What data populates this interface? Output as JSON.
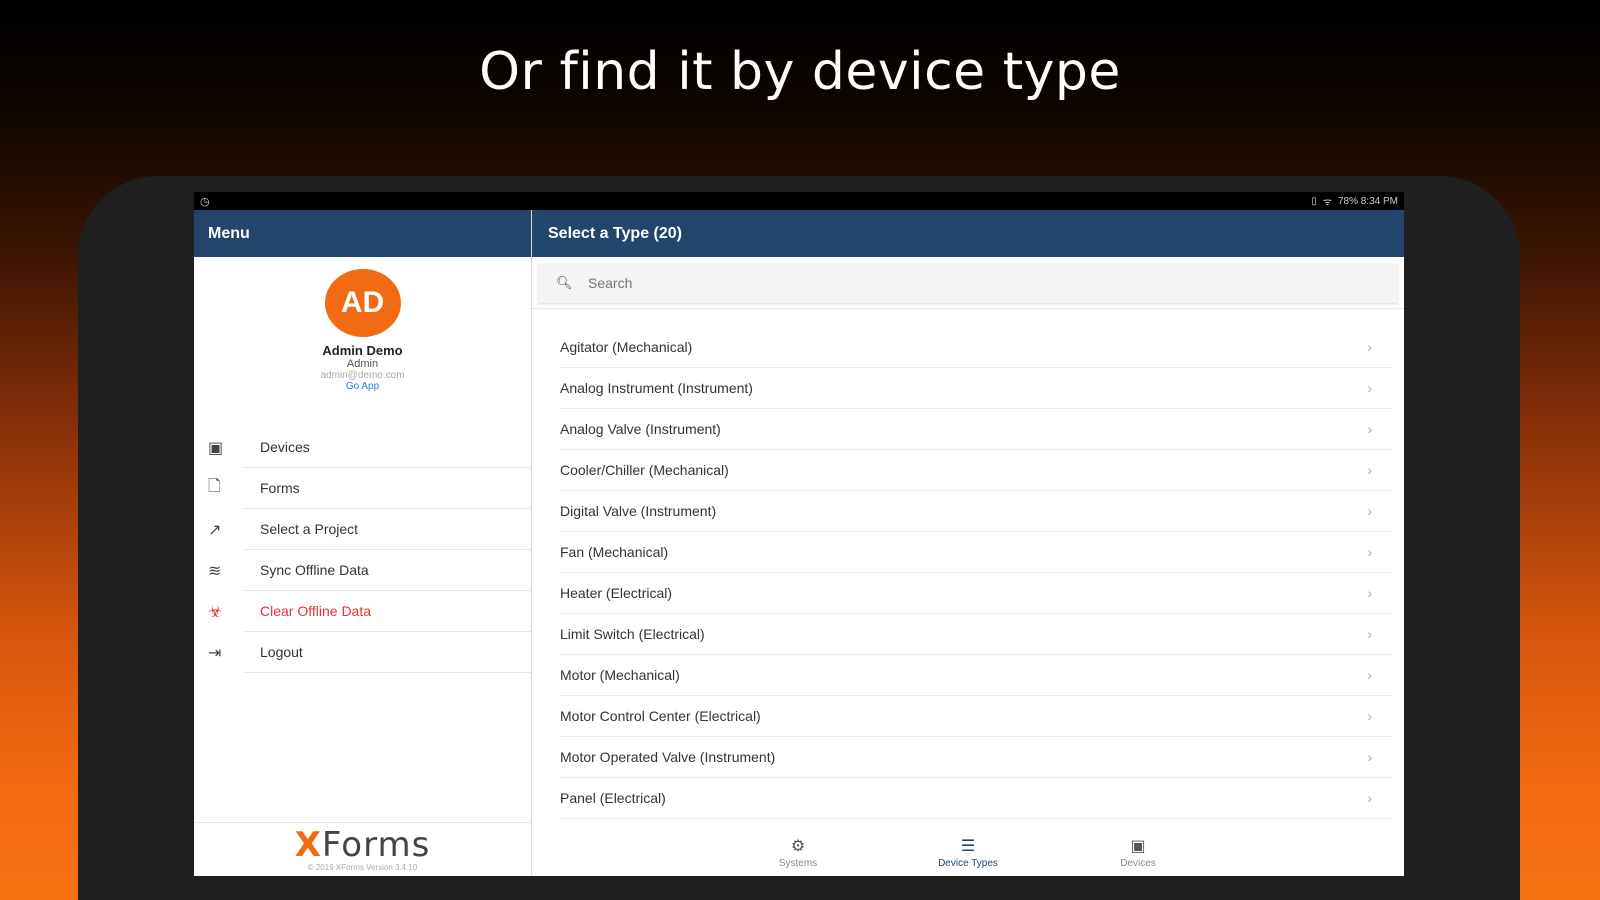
{
  "headline": "Or find it by device type",
  "statusbar": {
    "left_icon": "clock-icon",
    "right_text": "78% 8:34 PM"
  },
  "sidebar": {
    "title": "Menu",
    "profile": {
      "initials": "AD",
      "name": "Admin Demo",
      "role": "Admin",
      "email": "admin@demo.com",
      "link": "Go App"
    },
    "items": [
      {
        "label": "Devices",
        "icon": "device-icon"
      },
      {
        "label": "Forms",
        "icon": "document-icon"
      },
      {
        "label": "Select a Project",
        "icon": "chart-icon"
      },
      {
        "label": "Sync Offline Data",
        "icon": "wifi-icon"
      },
      {
        "label": "Clear Offline Data",
        "icon": "biohazard-icon"
      },
      {
        "label": "Logout",
        "icon": "logout-icon"
      }
    ],
    "logo": {
      "x": "X",
      "rest": "Forms"
    },
    "copyright": "© 2019 XForms Version 3.4.10"
  },
  "main": {
    "title": "Select a Type (20)",
    "search_placeholder": "Search",
    "items": [
      "Agitator (Mechanical)",
      "Analog Instrument (Instrument)",
      "Analog Valve (Instrument)",
      "Cooler/Chiller (Mechanical)",
      "Digital Valve (Instrument)",
      "Fan (Mechanical)",
      "Heater (Electrical)",
      "Limit Switch (Electrical)",
      "Motor (Mechanical)",
      "Motor Control Center (Electrical)",
      "Motor Operated Valve (Instrument)",
      "Panel (Electrical)"
    ],
    "tabs": [
      {
        "label": "Systems",
        "icon": "gear-icon"
      },
      {
        "label": "Device Types",
        "icon": "list-icon"
      },
      {
        "label": "Devices",
        "icon": "device-icon"
      }
    ]
  },
  "colors": {
    "accent": "#f26b12",
    "header": "#22466b",
    "danger": "#e3342f"
  }
}
